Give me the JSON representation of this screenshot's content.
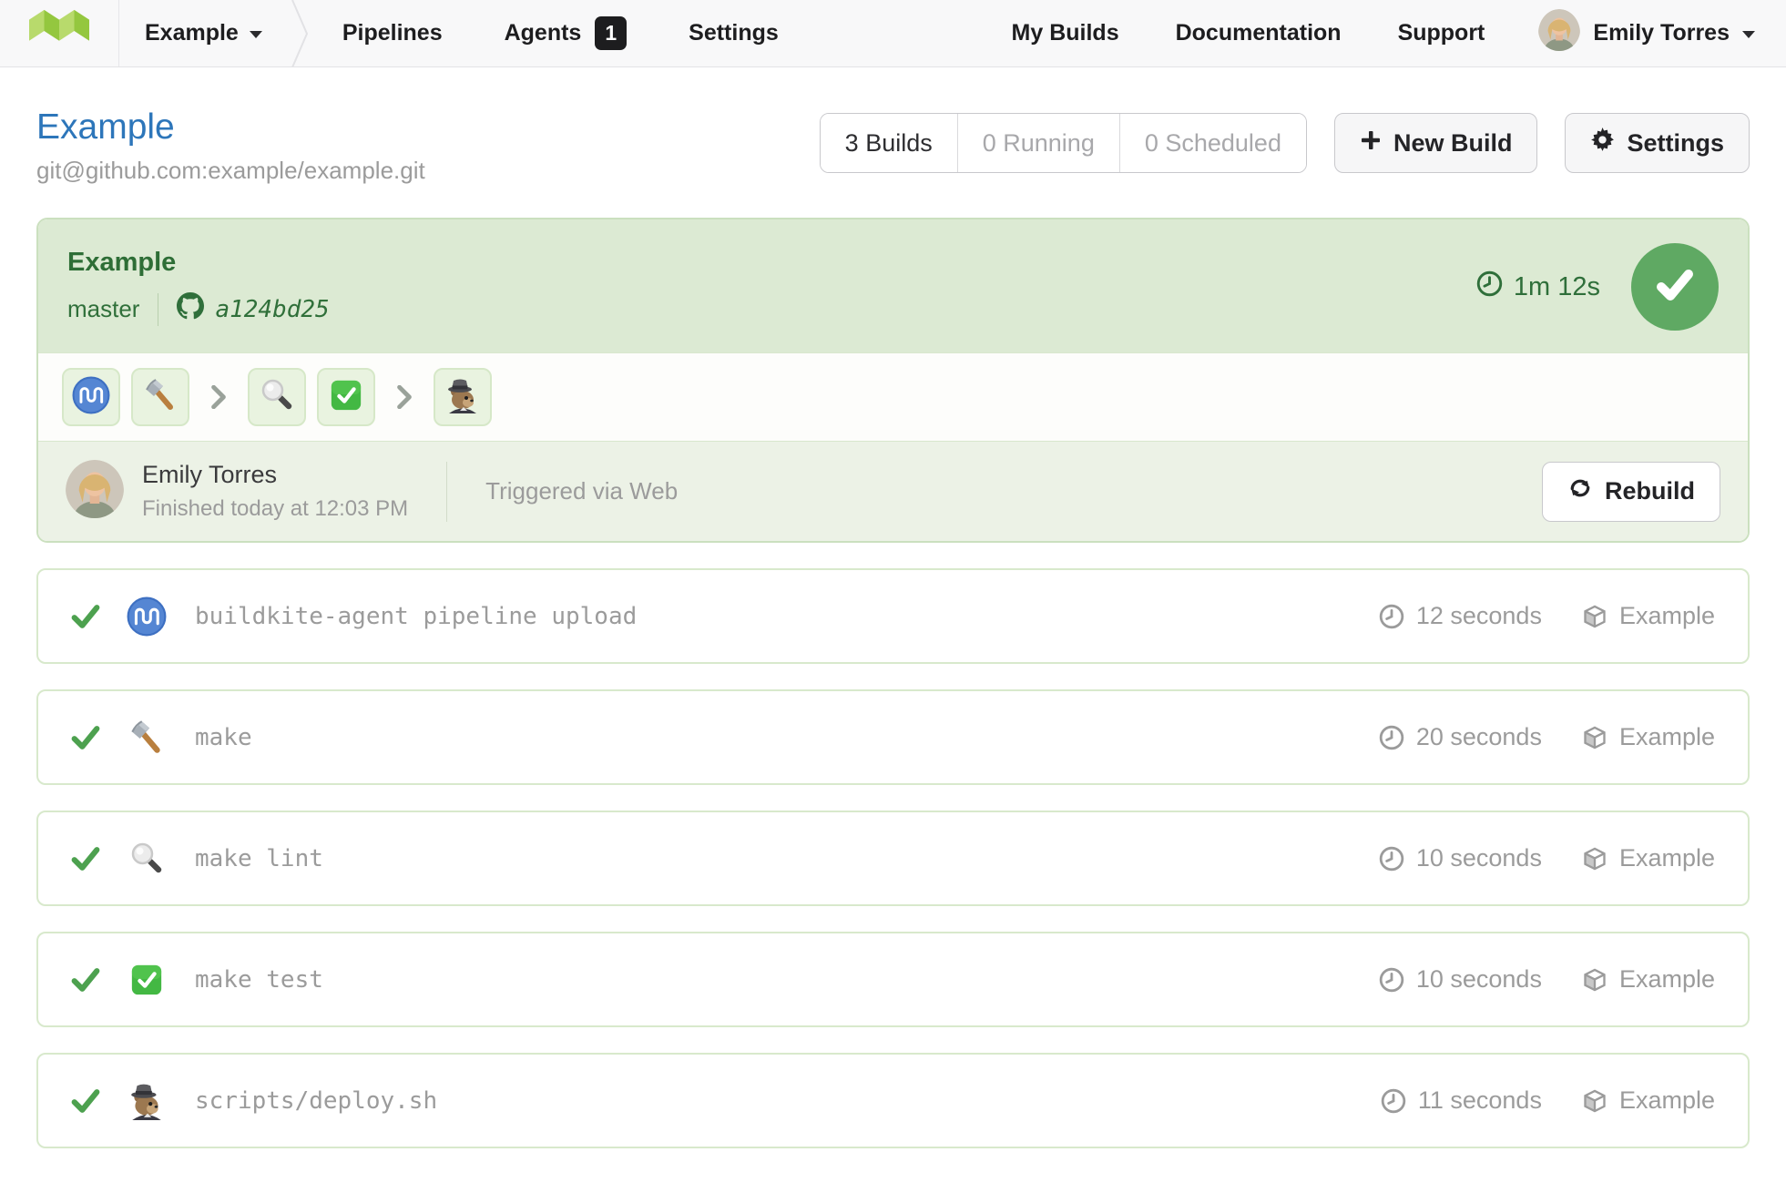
{
  "nav": {
    "org_name": "Example",
    "pipelines_label": "Pipelines",
    "agents_label": "Agents",
    "agents_badge": "1",
    "settings_label": "Settings",
    "my_builds_label": "My Builds",
    "documentation_label": "Documentation",
    "support_label": "Support",
    "user_name": "Emily Torres"
  },
  "header": {
    "title": "Example",
    "repo_url": "git@github.com:example/example.git",
    "builds_tab": "3 Builds",
    "running_tab": "0 Running",
    "scheduled_tab": "0 Scheduled",
    "new_build_label": "New Build",
    "settings_label": "Settings"
  },
  "build": {
    "pipeline_name": "Example",
    "branch": "master",
    "commit": "a124bd25",
    "duration": "1m 12s",
    "status": "passed",
    "creator_name": "Emily Torres",
    "finished_at": "Finished today at 12:03 PM",
    "trigger": "Triggered via Web",
    "rebuild_label": "Rebuild",
    "step_icons": [
      "buildkite-agent",
      "hammer",
      "magnifying-glass",
      "check-box",
      "squirrel"
    ]
  },
  "jobs": [
    {
      "icon": "buildkite-agent",
      "command": "buildkite-agent pipeline upload",
      "duration": "12 seconds",
      "agent": "Example",
      "status": "passed"
    },
    {
      "icon": "hammer",
      "command": "make",
      "duration": "20 seconds",
      "agent": "Example",
      "status": "passed"
    },
    {
      "icon": "magnifying-glass",
      "command": "make lint",
      "duration": "10 seconds",
      "agent": "Example",
      "status": "passed"
    },
    {
      "icon": "check-box",
      "command": "make test",
      "duration": "10 seconds",
      "agent": "Example",
      "status": "passed"
    },
    {
      "icon": "squirrel",
      "command": "scripts/deploy.sh",
      "duration": "11 seconds",
      "agent": "Example",
      "status": "passed"
    }
  ],
  "colors": {
    "brand_green_light": "#b8da6c",
    "brand_green_dark": "#94c73f",
    "link_blue": "#2d76ba",
    "success_green": "#5fa963",
    "build_header_bg": "#dcead3",
    "build_footer_bg": "#ecf2e6",
    "text_green": "#2f7036",
    "muted_gray": "#9b9b9b",
    "agent_icon_blue": "#5586d3"
  }
}
